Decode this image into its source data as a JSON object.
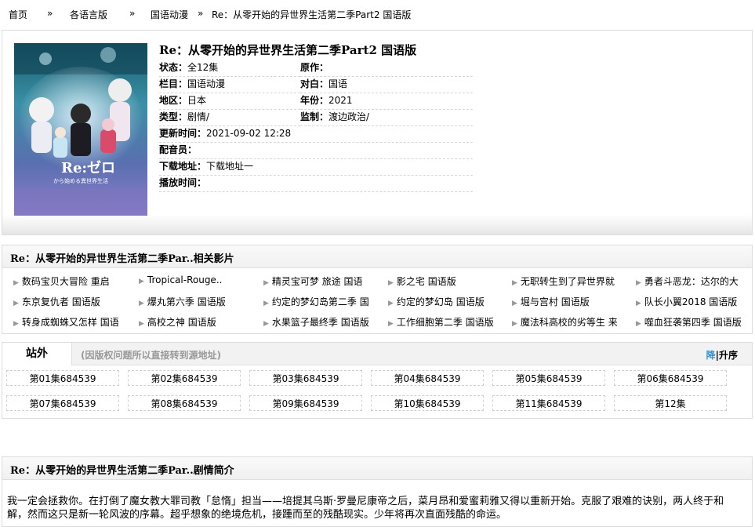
{
  "breadcrumb": [
    "首页",
    "»",
    "各语言版",
    "»",
    "国语动漫",
    "»",
    "Re：从零开始的异世界生活第二季Part2 国语版"
  ],
  "info": {
    "title": "Re：从零开始的异世界生活第二季Part2 国语版",
    "poster_logo": "Re:ゼロ",
    "poster_sub": "から始める異世界生活",
    "status_label": "状态：",
    "status": "全12集",
    "author_label": "原作：",
    "author": "",
    "column_label": "栏目：",
    "column": "国语动漫",
    "dub_label": "对白：",
    "dub": "国语",
    "region_label": "地区：",
    "region": "日本",
    "year_label": "年份：",
    "year": "2021",
    "genre_label": "类型：",
    "genre": "剧情/",
    "director_label": "监制：",
    "director": "渡边政治/",
    "updated_label": "更新时间：",
    "updated": "2021-09-02 12:28",
    "voice_label": "配音员：",
    "voice": "",
    "download_label": "下载地址：",
    "download": "下载地址一",
    "airtime_label": "播放时间：",
    "airtime": ""
  },
  "related": {
    "header": "Re：从零开始的异世界生活第二季Par..相关影片",
    "bullet": "▶",
    "items": [
      "数码宝贝大冒险 重启",
      "Tropical-Rouge..",
      "精灵宝可梦 旅途 国语",
      "影之宅 国语版",
      "无职转生到了异世界就",
      "勇者斗恶龙：达尔的大",
      "东京复仇者 国语版",
      "爆丸第六季 国语版",
      "约定的梦幻岛第二季 国",
      "约定的梦幻岛 国语版",
      "堀与宫村 国语版",
      "队长小翼2018 国语版",
      "转身成蜘蛛又怎样 国语",
      "高校之神 国语版",
      "水果篮子最终季 国语版",
      "工作细胞第二季 国语版",
      "魔法科高校的劣等生 来",
      "噬血狂袭第四季 国语版"
    ]
  },
  "sources": {
    "tab": "站外",
    "note": "(因版权问题所以直接转到源地址)",
    "sort_down": "降",
    "sort_sep": "|",
    "sort_up": "升序",
    "episodes": [
      "第01集684539",
      "第02集684539",
      "第03集684539",
      "第04集684539",
      "第05集684539",
      "第06集684539",
      "第07集684539",
      "第08集684539",
      "第09集684539",
      "第10集684539",
      "第11集684539",
      "第12集"
    ]
  },
  "plot": {
    "header": "Re：从零开始的异世界生活第二季Par..剧情简介",
    "text": "我一定会拯救你。在打倒了魔女教大罪司教「怠惰」担当——培提其乌斯·罗曼尼康帝之后，菜月昂和爱蜜莉雅又得以重新开始。克服了艰难的诀别，两人终于和解，然而这只是新一轮风波的序幕。超乎想象的绝境危机，接踵而至的残酷现实。少年将再次直面残酷的命运。"
  }
}
